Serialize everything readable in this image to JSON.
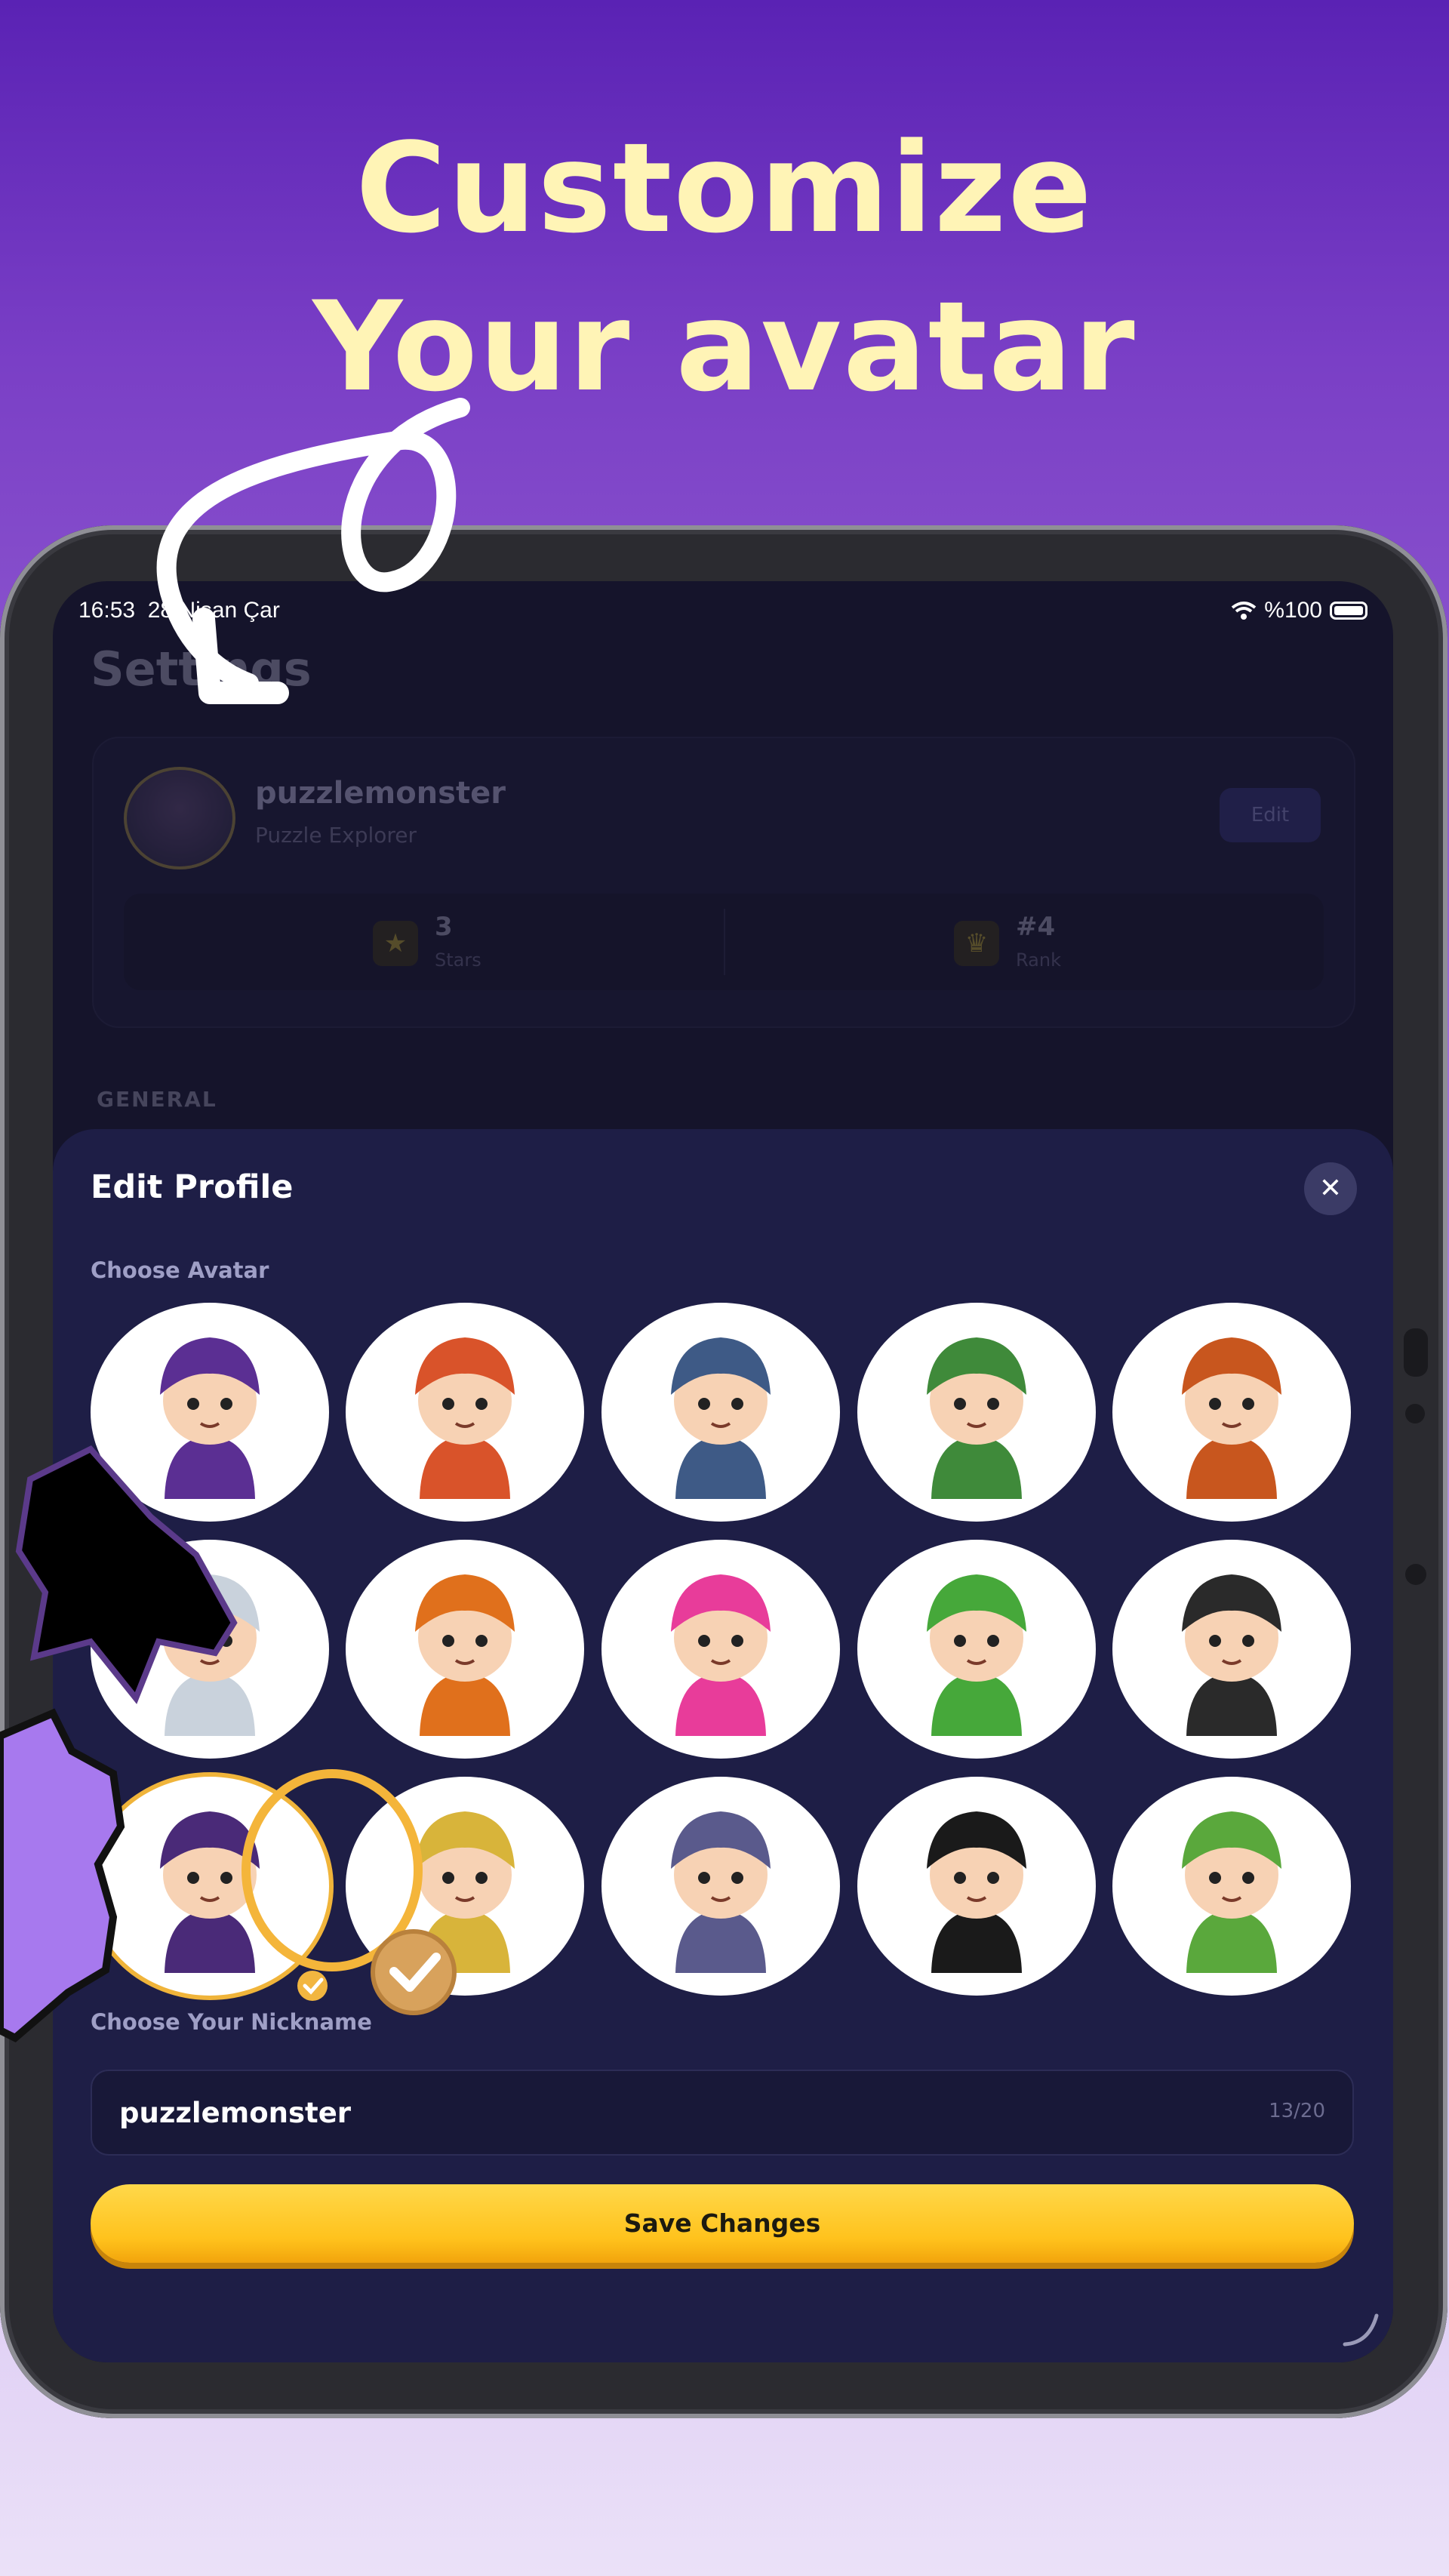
{
  "promo": {
    "line1": "Customize",
    "line2": "Your avatar"
  },
  "status_bar": {
    "time": "16:53",
    "date": "28 Nisan Çar",
    "battery": "%100",
    "icons": [
      "wifi-icon",
      "battery-icon"
    ]
  },
  "settings": {
    "title": "Settings",
    "profile": {
      "name": "puzzlemonster",
      "subtitle": "Puzzle Explorer",
      "edit_label": "Edit",
      "stats": [
        {
          "value": "3",
          "label": "Stars",
          "icon": "star-icon"
        },
        {
          "value": "#4",
          "label": "Rank",
          "icon": "trophy-icon"
        }
      ]
    },
    "section_general": "GENERAL"
  },
  "edit_profile": {
    "title": "Edit Profile",
    "close_icon": "close-icon",
    "choose_avatar_label": "Choose Avatar",
    "avatars": [
      {
        "id": "elf-archer-purple-hat",
        "color": "#5b2f93"
      },
      {
        "id": "fire-fairy",
        "color": "#d9532a"
      },
      {
        "id": "ninja-blue-helmet",
        "color": "#3e5a86"
      },
      {
        "id": "elf-green-hood",
        "color": "#3f8a3a"
      },
      {
        "id": "viking-orange-beard",
        "color": "#c8561e"
      },
      {
        "id": "astronaut",
        "color": "#c9d2dc"
      },
      {
        "id": "viking-girl",
        "color": "#e0701c"
      },
      {
        "id": "cyber-girl-pink",
        "color": "#e83c9a"
      },
      {
        "id": "green-turtle-dragon",
        "color": "#46a83a"
      },
      {
        "id": "samurai",
        "color": "#2a2a2a"
      },
      {
        "id": "witch-purple",
        "color": "#4a2a78",
        "selected": true
      },
      {
        "id": "elf-blonde",
        "color": "#d8b43a"
      },
      {
        "id": "ninja-girl",
        "color": "#5a5a8c"
      },
      {
        "id": "pirate-girl",
        "color": "#1a1a1a"
      },
      {
        "id": "baby-dragon-green",
        "color": "#5aa83c"
      }
    ],
    "choose_nickname_label": "Choose Your Nickname",
    "nickname": "puzzlemonster",
    "nickname_count": "13/20",
    "save_label": "Save Changes"
  },
  "colors": {
    "accent": "#ffc21c",
    "sheet": "#1e1e46",
    "headline": "#fff4b6"
  }
}
